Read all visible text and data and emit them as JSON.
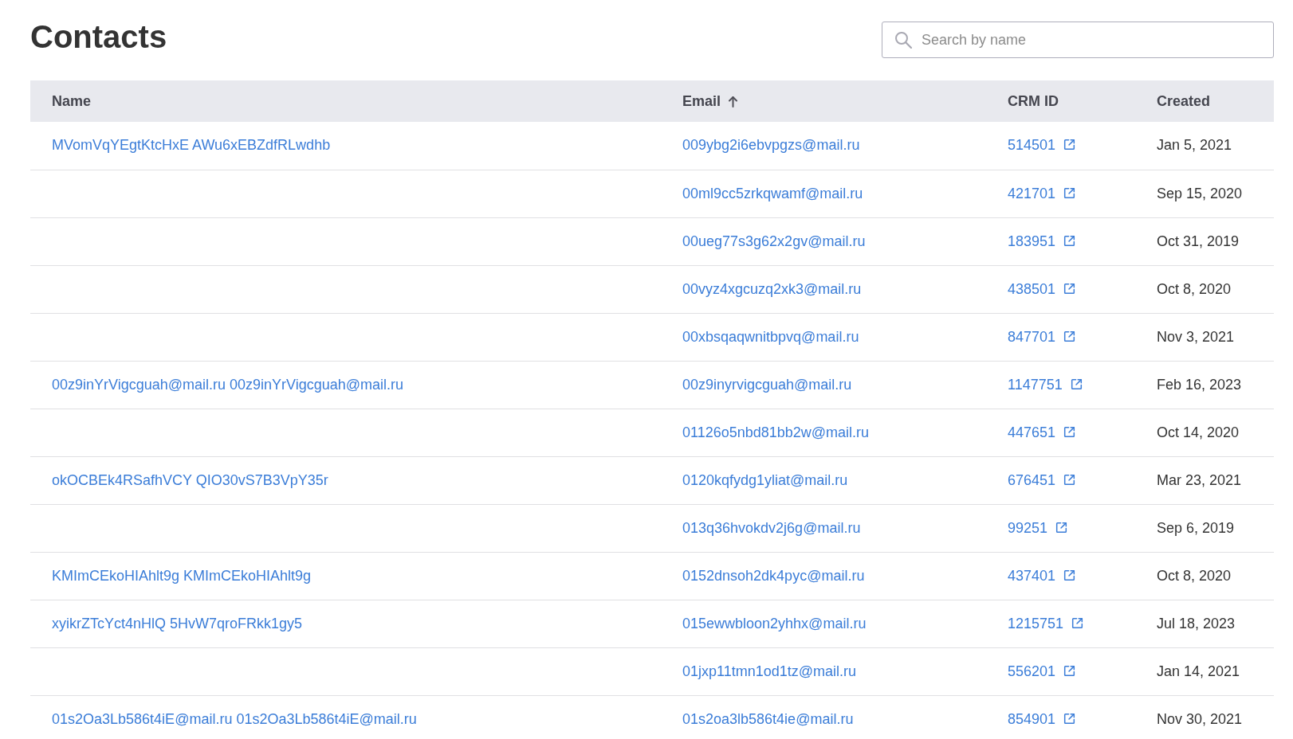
{
  "title": "Contacts",
  "search": {
    "placeholder": "Search by name"
  },
  "table": {
    "columns": [
      {
        "label": "Name",
        "sorted": false
      },
      {
        "label": "Email",
        "sorted": true
      },
      {
        "label": "CRM ID",
        "sorted": false
      },
      {
        "label": "Created",
        "sorted": false
      }
    ],
    "rows": [
      {
        "name": "MVomVqYEgtKtcHxE AWu6xEBZdfRLwdhb",
        "email": "009ybg2i6ebvpgzs@mail.ru",
        "crm_id": "514501",
        "created": "Jan 5, 2021"
      },
      {
        "email": "00ml9cc5zrkqwamf@mail.ru",
        "crm_id": "421701",
        "created": "Sep 15, 2020"
      },
      {
        "email": "00ueg77s3g62x2gv@mail.ru",
        "crm_id": "183951",
        "created": "Oct 31, 2019"
      },
      {
        "email": "00vyz4xgcuzq2xk3@mail.ru",
        "crm_id": "438501",
        "created": "Oct 8, 2020"
      },
      {
        "email": "00xbsqaqwnitbpvq@mail.ru",
        "crm_id": "847701",
        "created": "Nov 3, 2021"
      },
      {
        "name": "00z9inYrVigcguah@mail.ru 00z9inYrVigcguah@mail.ru",
        "email": "00z9inyrvigcguah@mail.ru",
        "crm_id": "1147751",
        "created": "Feb 16, 2023"
      },
      {
        "email": "01126o5nbd81bb2w@mail.ru",
        "crm_id": "447651",
        "created": "Oct 14, 2020"
      },
      {
        "name": "okOCBEk4RSafhVCY QIO30vS7B3VpY35r",
        "email": "0120kqfydg1yliat@mail.ru",
        "crm_id": "676451",
        "created": "Mar 23, 2021"
      },
      {
        "email": "013q36hvokdv2j6g@mail.ru",
        "crm_id": "99251",
        "created": "Sep 6, 2019"
      },
      {
        "name": "KMImCEkoHIAhlt9g KMImCEkoHIAhlt9g",
        "email": "0152dnsoh2dk4pyc@mail.ru",
        "crm_id": "437401",
        "created": "Oct 8, 2020"
      },
      {
        "name": "xyikrZTcYct4nHlQ 5HvW7qroFRkk1gy5",
        "email": "015ewwbloon2yhhx@mail.ru",
        "crm_id": "1215751",
        "created": "Jul 18, 2023"
      },
      {
        "email": "01jxp11tmn1od1tz@mail.ru",
        "crm_id": "556201",
        "created": "Jan 14, 2021"
      },
      {
        "name": "01s2Oa3Lb586t4iE@mail.ru 01s2Oa3Lb586t4iE@mail.ru",
        "email": "01s2oa3lb586t4ie@mail.ru",
        "crm_id": "854901",
        "created": "Nov 30, 2021"
      }
    ]
  }
}
